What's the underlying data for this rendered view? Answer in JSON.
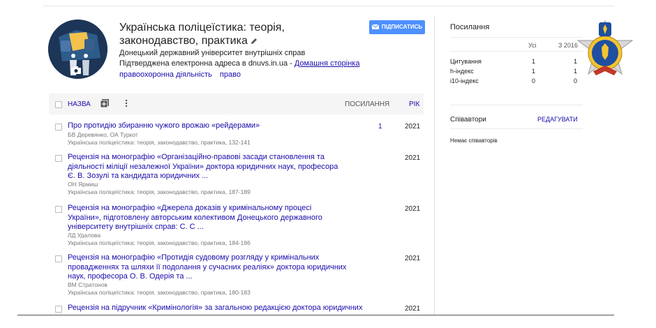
{
  "profile": {
    "title": "Українська поліцеїстика: теорія, законодавство, практика",
    "affiliation": "Донецький державний університет внутрішніх справ",
    "email_prefix": "Підтверджена електронна адреса в dnuvs.in.ua - ",
    "homepage_label": "Домашня сторінка",
    "tags": [
      "правоохоронна діяльність",
      "право"
    ],
    "follow_label": "ПІДПИСАТИСЬ"
  },
  "table": {
    "col_name": "НАЗВА",
    "col_citations": "ПОСИЛАННЯ",
    "col_year": "РІК",
    "rows": [
      {
        "title": "Про протидію збиранню чужого врожаю «рейдерами»",
        "authors": "БВ Деревянко, ОА Туркот",
        "venue": "Українська поліцеїстика: теорія, законодавство, практика, 132-141",
        "citations": "1",
        "year": "2021"
      },
      {
        "title": "Рецензія на монографію «Організаційно-правові засади становлення та діяльності міліції незалежної України» доктора юридичних наук, професора Є. В. Зозулі та кандидата юридичних ...",
        "authors": "ОН Ярмиш",
        "venue": "Українська поліцеїстика: теорія, законодавство, практика, 187-189",
        "citations": "",
        "year": "2021"
      },
      {
        "title": "Рецензія на монографію «Джерела доказів у кримінальному процесі України», підготовлену авторським колективом Донецького державного університету внутрішніх справ: С. С ...",
        "authors": "ЛД Удалова",
        "venue": "Українська поліцеїстика: теорія, законодавство, практика, 184-186",
        "citations": "",
        "year": "2021"
      },
      {
        "title": "Рецензія на монографію «Протидія судовому розгляду у кримінальних провадженнях та шляхи її подолання у сучасних реаліях» доктора юридичних наук, професора О. В. Одерія та ...",
        "authors": "ВМ Стратонов",
        "venue": "Українська поліцеїстика: теорія, законодавство, практика, 180-183",
        "citations": "",
        "year": "2021"
      },
      {
        "title": "Рецензія на підручник «Кримінологія» за загальною редакцією доктора юридичних",
        "authors": "",
        "venue": "",
        "citations": "",
        "year": "2021"
      }
    ]
  },
  "metrics": {
    "title": "Посилання",
    "col_all": "Усі",
    "col_since": "З 2016",
    "rows": [
      {
        "label": "Цитування",
        "all": "1",
        "since": "1"
      },
      {
        "label": "h-індекс",
        "all": "1",
        "since": "1"
      },
      {
        "label": "i10-індекс",
        "all": "0",
        "since": "0"
      }
    ]
  },
  "coauthors": {
    "title": "Співавтори",
    "edit_label": "РЕДАГУВАТИ",
    "empty_label": "Немає співавторів"
  },
  "colors": {
    "link": "#1a0dab",
    "button": "#4d90fe",
    "header_bg": "#f5f5f5"
  }
}
